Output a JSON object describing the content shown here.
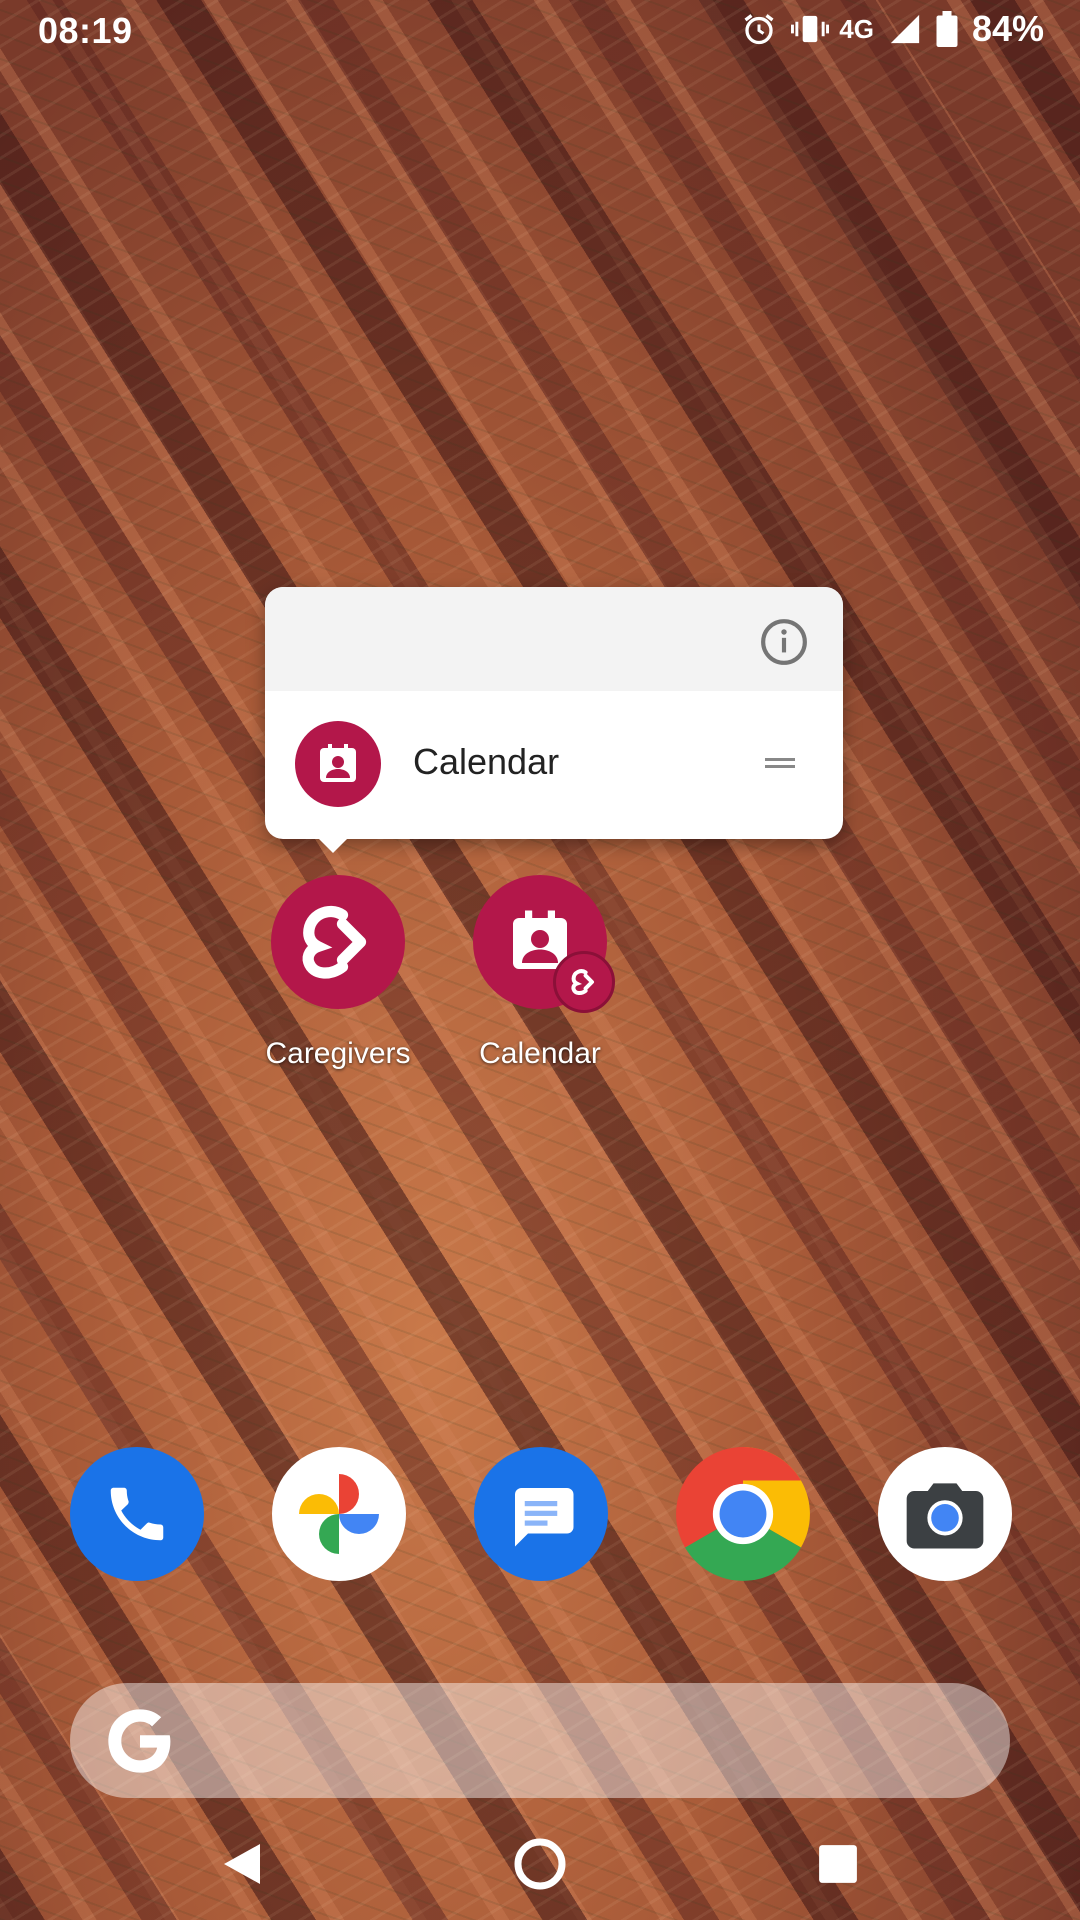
{
  "status_bar": {
    "time": "08:19",
    "network": "4G",
    "battery": "84%"
  },
  "popup": {
    "shortcut_label": "Calendar"
  },
  "home_apps": [
    {
      "label": "Caregivers"
    },
    {
      "label": "Calendar"
    }
  ],
  "dock": [
    "phone-icon",
    "photos-icon",
    "messages-icon",
    "chrome-icon",
    "camera-icon"
  ],
  "colors": {
    "brand": "#b3174a",
    "phone": "#1a73e8",
    "messages": "#1a73e8"
  }
}
